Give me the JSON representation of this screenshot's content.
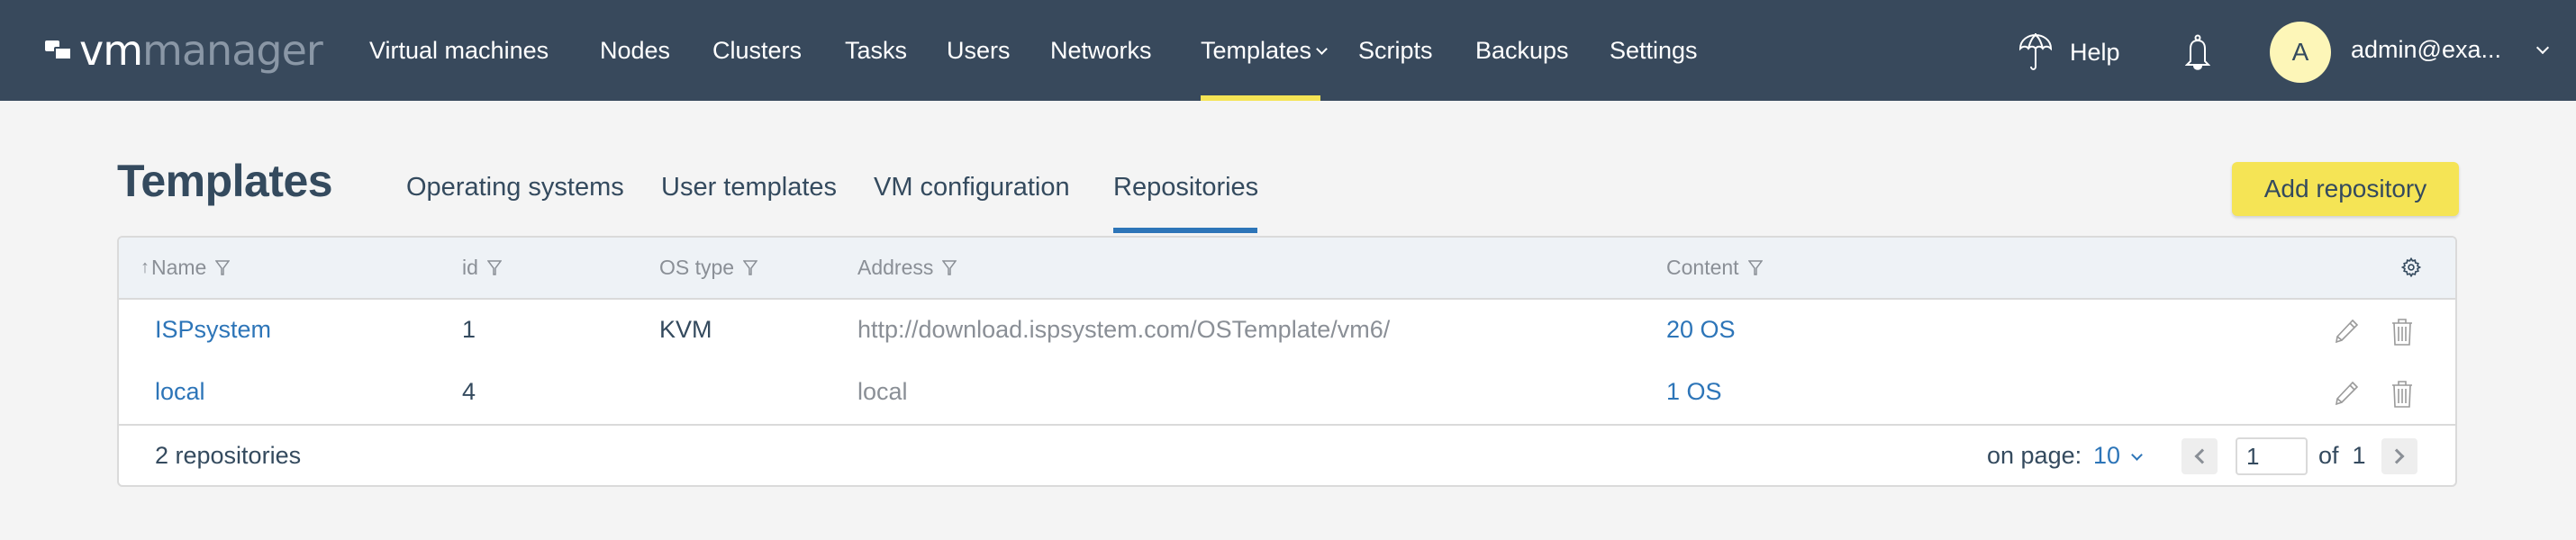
{
  "header": {
    "logo": {
      "part1": "vm",
      "part2": "manager"
    },
    "nav": [
      {
        "label": "Virtual machines"
      },
      {
        "label": "Nodes"
      },
      {
        "label": "Clusters"
      },
      {
        "label": "Tasks"
      },
      {
        "label": "Users"
      },
      {
        "label": "Networks"
      },
      {
        "label": "Templates",
        "active": true,
        "has_dropdown": true
      },
      {
        "label": "Scripts"
      },
      {
        "label": "Backups"
      },
      {
        "label": "Settings"
      }
    ],
    "help_label": "Help",
    "avatar_letter": "A",
    "user_email": "admin@exa..."
  },
  "page": {
    "title": "Templates",
    "tabs": [
      {
        "label": "Operating systems"
      },
      {
        "label": "User templates"
      },
      {
        "label": "VM configuration"
      },
      {
        "label": "Repositories",
        "active": true
      }
    ],
    "add_button_label": "Add repository"
  },
  "table": {
    "columns": [
      {
        "label": "Name",
        "sort": "↑"
      },
      {
        "label": "id"
      },
      {
        "label": "OS type"
      },
      {
        "label": "Address"
      },
      {
        "label": "Content"
      }
    ],
    "rows": [
      {
        "name": "ISPsystem",
        "id": "1",
        "os_type": "KVM",
        "address": "http://download.ispsystem.com/OSTemplate/vm6/",
        "content": "20 OS"
      },
      {
        "name": "local",
        "id": "4",
        "os_type": "",
        "address": "local",
        "content": "1 OS"
      }
    ],
    "footer": {
      "count": "2 repositories",
      "on_page_label": "on page:",
      "on_page_value": "10",
      "current_page": "1",
      "of_label": "of",
      "total_pages": "1"
    }
  },
  "colors": {
    "header_bg": "#38495c",
    "accent_yellow": "#f5e455",
    "link_blue": "#2d75b8",
    "text_dark": "#344a5e"
  }
}
